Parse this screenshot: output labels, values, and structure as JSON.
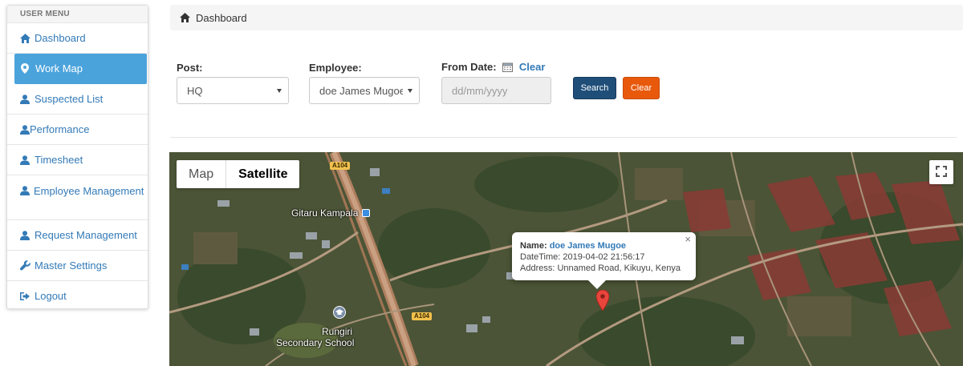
{
  "sidebar": {
    "header": "USER MENU",
    "items": [
      {
        "label": "Dashboard",
        "icon": "home-icon"
      },
      {
        "label": "Work Map",
        "icon": "map-marker-icon",
        "active": true
      },
      {
        "label": "Suspected List",
        "icon": "user-icon"
      },
      {
        "label": "Performance",
        "icon": "user-icon"
      },
      {
        "label": "Timesheet",
        "icon": "user-icon"
      },
      {
        "label": "Employee Management",
        "icon": "user-icon"
      },
      {
        "label": "Request Management",
        "icon": "user-icon"
      },
      {
        "label": "Master Settings",
        "icon": "wrench-icon"
      },
      {
        "label": "Logout",
        "icon": "logout-icon"
      }
    ]
  },
  "breadcrumb": {
    "label": "Dashboard"
  },
  "filters": {
    "post_label": "Post:",
    "post_value": "HQ",
    "employee_label": "Employee:",
    "employee_value": "doe James Mugoe",
    "from_date_label": "From Date:",
    "from_date_clear": "Clear",
    "date_placeholder": "dd/mm/yyyy",
    "search_button": "Search",
    "clear_button": "Clear"
  },
  "map": {
    "type_map": "Map",
    "type_satellite": "Satellite",
    "labels": {
      "gitaru": "Gitaru Kampala",
      "rungiri_1": "Rungiri",
      "rungiri_2": "Secondary School",
      "road_1": "A104",
      "road_2": "A104"
    },
    "infowindow": {
      "name_key": "Name:",
      "name_value": "doe James Mugoe",
      "datetime": "DateTime: 2019-04-02 21:56:17",
      "address": "Address: Unnamed Road, Kikuyu, Kenya",
      "close": "×"
    }
  },
  "colors": {
    "active_menu": "#4ba3dc",
    "link": "#337ab7",
    "search_btn": "#1f4e79",
    "clear_btn": "#e8590c",
    "pin": "#e8453c"
  }
}
